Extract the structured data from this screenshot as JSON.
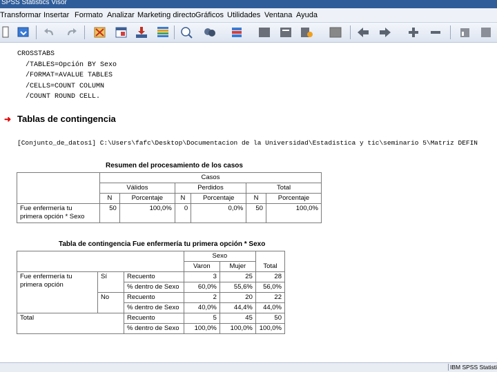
{
  "window": {
    "title": "SPSS Statistics Visor"
  },
  "menu": [
    "Transformar",
    "Insertar",
    "Formato",
    "Analizar",
    "Marketing directo",
    "Gráficos",
    "Utilidades",
    "Ventana",
    "Ayuda"
  ],
  "toolbar": {
    "icons": [
      "print-preview-icon",
      "export-icon",
      "undo-icon",
      "redo-icon",
      "goto-data-icon",
      "goto-case-icon",
      "goto-variable-icon",
      "variables-icon",
      "dialog-recall-icon",
      "select-cases-icon",
      "value-labels-icon",
      "promote-icon",
      "demote-icon",
      "show-all-icon",
      "hide-icon",
      "insert-heading-icon",
      "insert-text-icon",
      "designate-window-icon",
      "back-icon",
      "forward-icon",
      "expand-icon",
      "collapse-icon",
      "chart-builder-icon",
      "new-title-icon"
    ]
  },
  "syntax": {
    "lines": [
      "CROSSTABS",
      "  /TABLES=Opción BY Sexo",
      "  /FORMAT=AVALUE TABLES",
      "  /CELLS=COUNT COLUMN",
      "  /COUNT ROUND CELL."
    ]
  },
  "output": {
    "heading": "Tablas de contingencia",
    "dataset": "[Conjunto_de_datos1] C:\\Users\\fafc\\Desktop\\Documentacion de la Universidad\\Estadistica y tic\\seminario 5\\Matriz DEFIN"
  },
  "summary_table": {
    "title": "Resumen del procesamiento de los casos",
    "casos_label": "Casos",
    "groups": [
      "Válidos",
      "Perdidos",
      "Total"
    ],
    "subheaders": [
      "N",
      "Porcentaje",
      "N",
      "Porcentaje",
      "N",
      "Porcentaje"
    ],
    "row_label_1": "Fue enfermería tu",
    "row_label_2": "primera opción * Sexo",
    "values": [
      "50",
      "100,0%",
      "0",
      "0,0%",
      "50",
      "100,0%"
    ]
  },
  "contingency_table": {
    "title": "Tabla de contingencia Fue enfermería tu primera opción * Sexo",
    "sexo_label": "Sexo",
    "col_headers": [
      "Varon",
      "Mujer"
    ],
    "total_header": "Total",
    "row_var_1": "Fue enfermería tu",
    "row_var_2": "primera opción",
    "total_label": "Total",
    "rows": [
      {
        "group": "Sí",
        "stat": "Recuento",
        "values": [
          "3",
          "25",
          "28"
        ]
      },
      {
        "group": "",
        "stat": "% dentro de Sexo",
        "values": [
          "60,0%",
          "55,6%",
          "56,0%"
        ]
      },
      {
        "group": "No",
        "stat": "Recuento",
        "values": [
          "2",
          "20",
          "22"
        ]
      },
      {
        "group": "",
        "stat": "% dentro de Sexo",
        "values": [
          "40,0%",
          "44,4%",
          "44,0%"
        ]
      },
      {
        "group": "",
        "stat": "Recuento",
        "values": [
          "5",
          "45",
          "50"
        ]
      },
      {
        "group": "",
        "stat": "% dentro de Sexo",
        "values": [
          "100,0%",
          "100,0%",
          "100,0%"
        ]
      }
    ]
  },
  "status": {
    "text": "IBM SPSS Statistics"
  },
  "colors": {
    "titlebar": "#2f5d9a",
    "arrow": "#e00000",
    "menubar": "#eef2f8"
  }
}
